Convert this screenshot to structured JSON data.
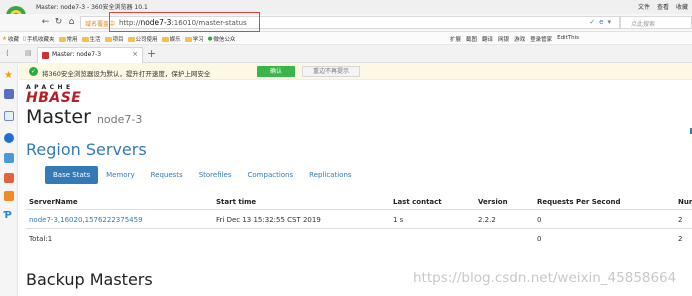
{
  "browser": {
    "window_title": "Master: node7-3 - 360安全浏览器 10.1",
    "menu": [
      "文件",
      "查看",
      "收藏"
    ],
    "address": {
      "prefix": "域名覆盖中",
      "scheme": "http://",
      "host": "node7-3",
      "rest": ":16010/master-status"
    },
    "search_placeholder": "点此搜索",
    "bookmarks": [
      "收藏",
      "手机收藏夹",
      "常用",
      "生活",
      "项目",
      "公司使用",
      "娱乐",
      "学习",
      "微信公众"
    ],
    "bookmark_tools": [
      "扩展",
      "截图",
      "翻译",
      "网银",
      "游戏",
      "登录管家",
      "EditThis"
    ],
    "tab_label": "Master: node7-3",
    "notification": {
      "text": "将360安全浏览器设为默认，提升打开速度，保护上网安全",
      "ok_label": "确认",
      "dismiss_label": "重边不再提示"
    }
  },
  "page": {
    "logo_top": "APACHE",
    "logo_main": "HBASE",
    "title": "Master",
    "host": "node7-3",
    "region_servers_title": "Region Servers",
    "tabs": [
      "Base Stats",
      "Memory",
      "Requests",
      "Storefiles",
      "Compactions",
      "Replications"
    ],
    "active_tab": "Base Stats",
    "table": {
      "headers": [
        "ServerName",
        "Start time",
        "Last contact",
        "Version",
        "Requests Per Second",
        "Num"
      ],
      "rows": [
        [
          "node7-3,16020,1576222375459",
          "Fri Dec 13 15:32:55 CST 2019",
          "1 s",
          "2.2.2",
          "0",
          "2"
        ]
      ],
      "total": [
        "Total:1",
        "",
        "",
        "",
        "0",
        "2"
      ]
    },
    "backup_masters_title": "Backup Masters",
    "watermark": "https://blog.csdn.net/weixin_45858664"
  }
}
